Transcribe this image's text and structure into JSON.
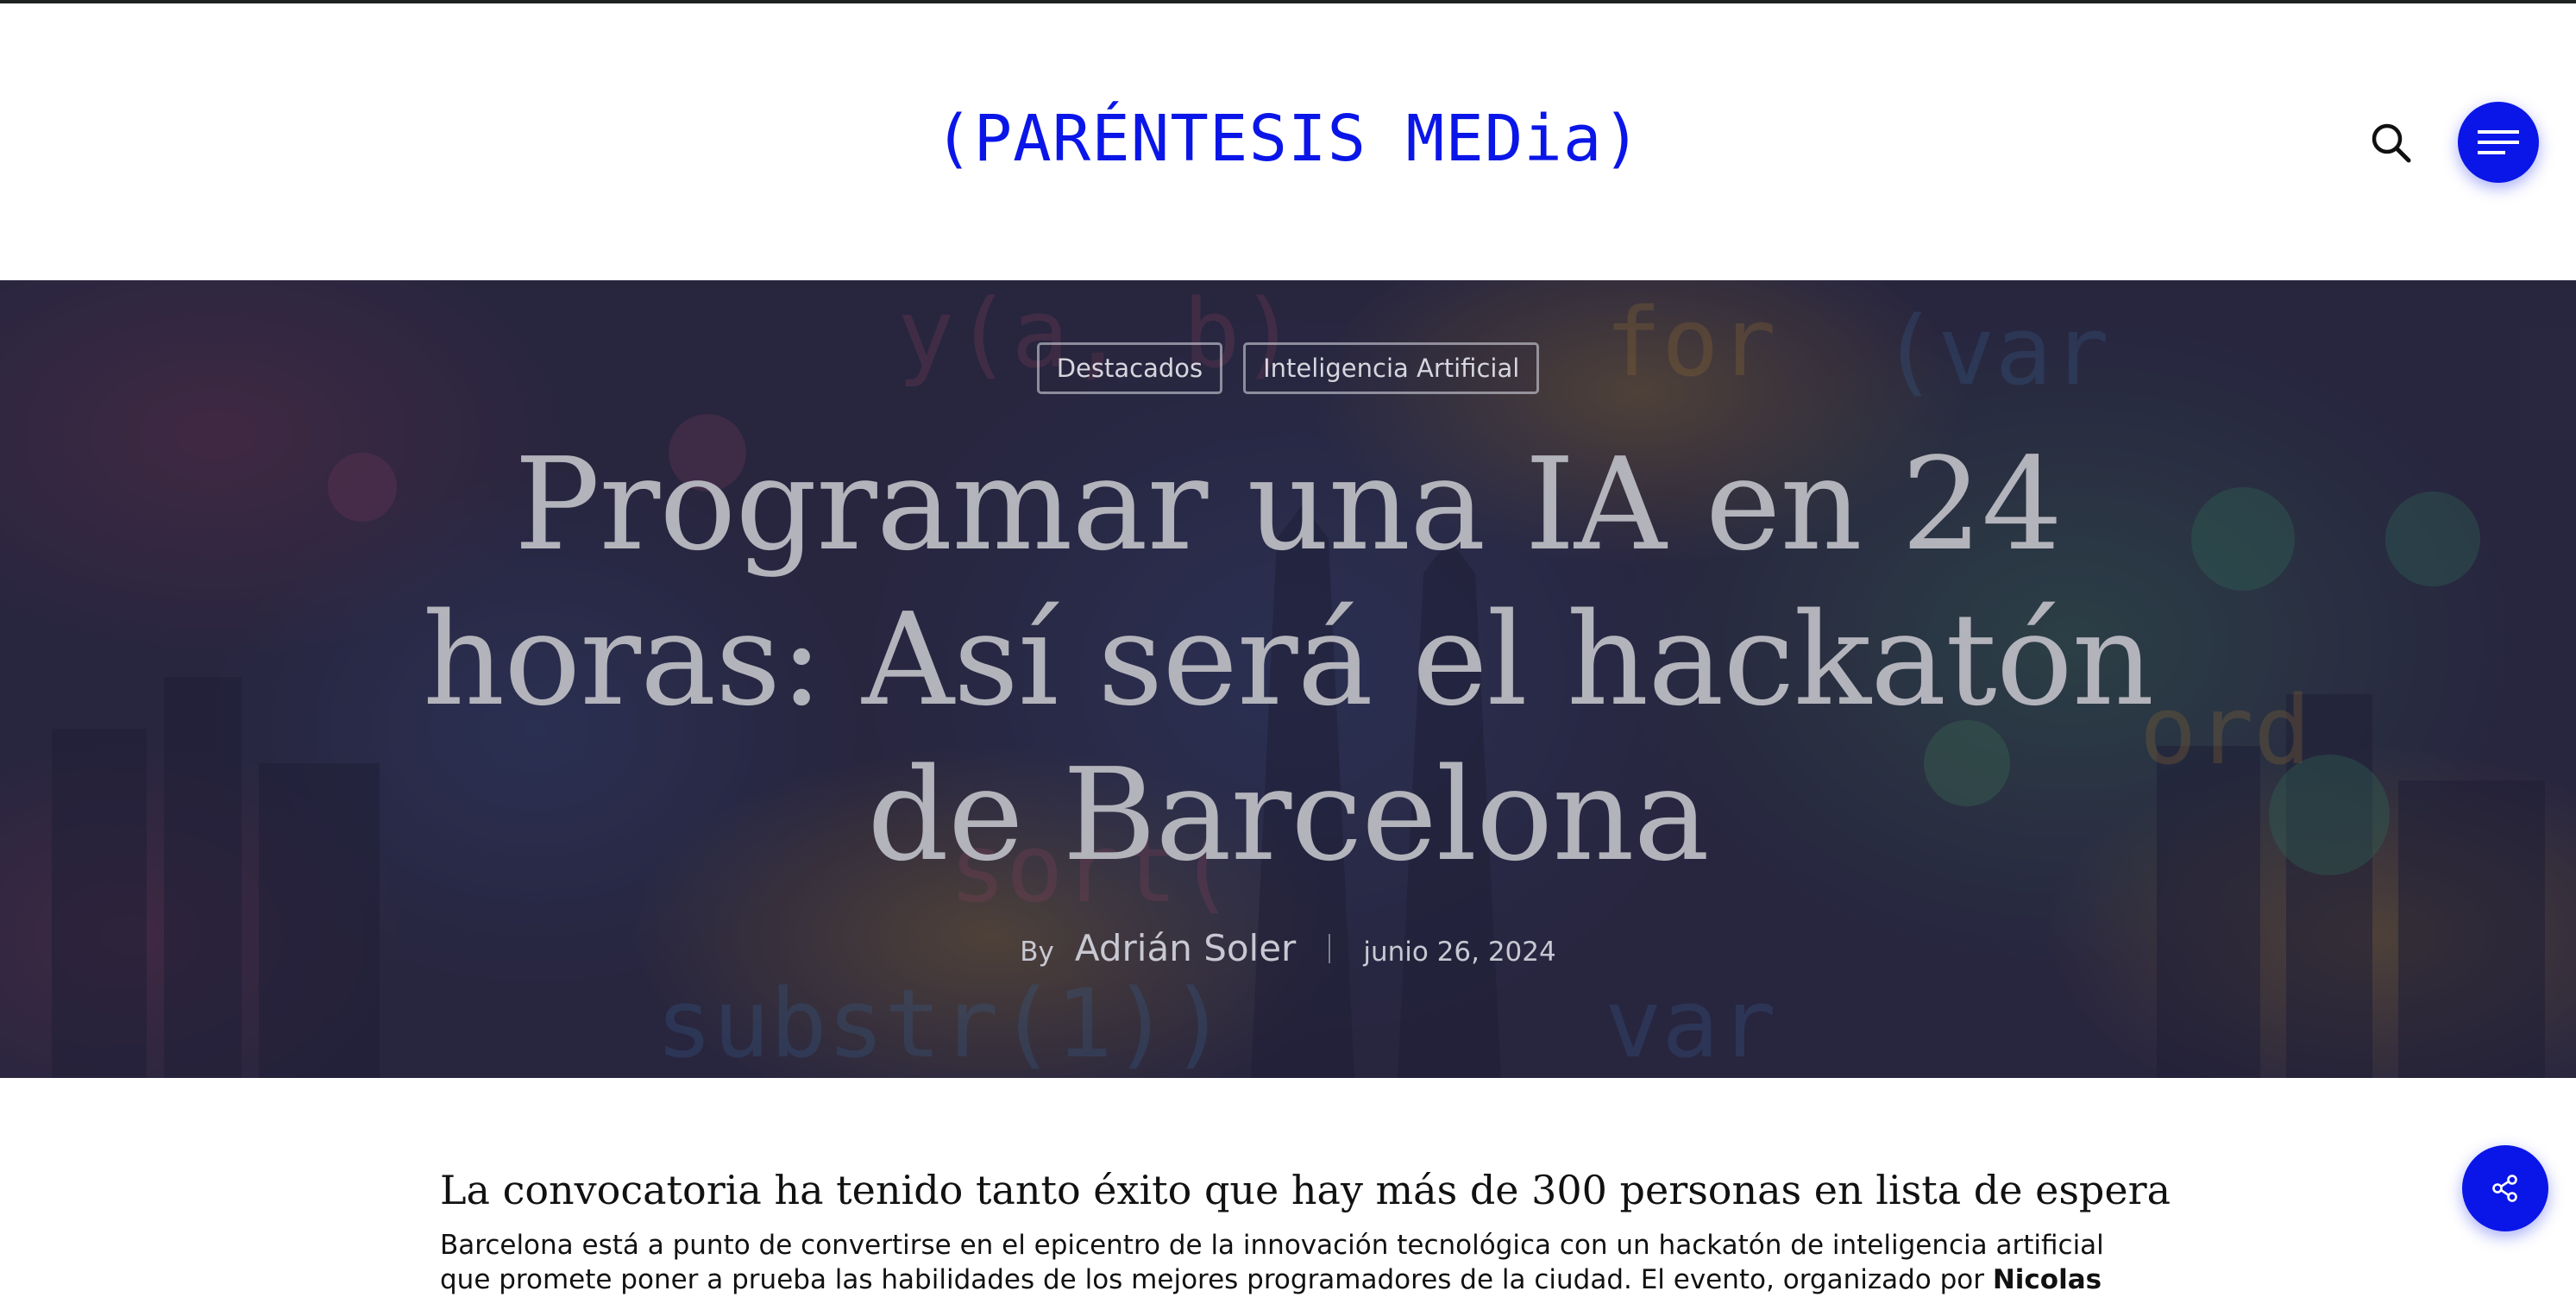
{
  "site": {
    "logo_text": "(PARÉNTESIS MEDia)",
    "accent_color": "#0a16e8",
    "search_icon": "search-icon",
    "menu_icon": "hamburger-menu-icon"
  },
  "hero": {
    "categories": [
      "Destacados",
      "Inteligencia Artificial"
    ],
    "title_lines": [
      "Programar una IA en 24",
      "horas: Así será el hackatón",
      "de Barcelona"
    ],
    "by_label": "By",
    "author": "Adrián Soler",
    "date": "junio 26, 2024"
  },
  "article": {
    "subtitle": "La convocatoria ha tenido tanto éxito que hay más de 300 personas en lista de espera",
    "paragraph_line1": "Barcelona está a punto de convertirse en el epicentro de la innovación tecnológica con un hackatón de inteligencia artificial",
    "paragraph_line2_start": "que promete poner a prueba las habilidades de los mejores programadores de la ciudad. El evento, organizado por ",
    "paragraph_bold": "Nicolas"
  },
  "share": {
    "icon": "share-icon"
  }
}
